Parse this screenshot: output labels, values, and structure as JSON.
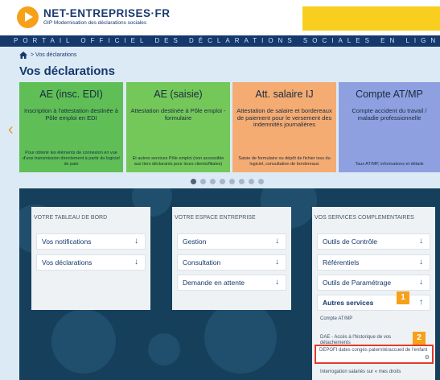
{
  "header": {
    "brand": "NET-ENTREPRISES·FR",
    "brand_sub": "GIP Modernisation des déclarations sociales",
    "portal_bar": "PORTAIL OFFICIEL DES DÉCLARATIONS SOCIALES EN LIGNE",
    "accent": "#f7a11a",
    "navy": "#15386d"
  },
  "breadcrumb": {
    "label": "> Vos déclarations"
  },
  "page_title": "Vos déclarations",
  "carousel": {
    "cards": [
      {
        "title": "AE (insc. EDI)",
        "desc": "Inscription à l'attestation destinée à Pôle emploi en EDI",
        "foot": "Pour obtenir les éléments de connexion en vue d'une transmission directement à partir du logiciel de paie",
        "color": "#5fbf56"
      },
      {
        "title": "AE (saisie)",
        "desc": "Attestation destinée à Pôle emploi - formulaire",
        "foot": "Et autres services Pôle emploi (non accessible aux tiers déclarants pour leurs clients/filiales)",
        "color": "#74c85a"
      },
      {
        "title": "Att. salaire IJ",
        "desc": "Attestation de salaire et bordereaux de paiement pour le versement des indemnités journalières",
        "foot": "Saisie de formulaire ou dépôt de fichier issu du logiciel, consultation de bordereaux",
        "color": "#f4ac73"
      },
      {
        "title": "Compte AT/MP",
        "desc": "Compte accident du travail / maladie professionnelle",
        "foot": "Taux AT/MP, informations et détails",
        "color": "#8fa0e0"
      }
    ],
    "dots_count": 8,
    "active_dot": 0
  },
  "panels": {
    "tableau": {
      "heading": "VOTRE TABLEAU DE BORD",
      "items": [
        "Vos notifications",
        "Vos déclarations"
      ]
    },
    "espace": {
      "heading": "VOTRE ESPACE ENTREPRISE",
      "items": [
        "Gestion",
        "Consultation",
        "Demande en attente"
      ]
    },
    "services": {
      "heading": "VOS SERVICES COMPLEMENTAIRES",
      "items": [
        "Outils de Contrôle",
        "Référentiels",
        "Outils de Paramétrage",
        "Autres services"
      ],
      "sub_items": [
        "Compte AT/MP",
        "DAE - Accès à l'historique de vos détachements",
        "DEPOFI dates congés paternité/accueil de l'enfant",
        "Interrogation salariés sur « mes droits"
      ]
    }
  },
  "badges": {
    "one": "1",
    "two": "2"
  }
}
